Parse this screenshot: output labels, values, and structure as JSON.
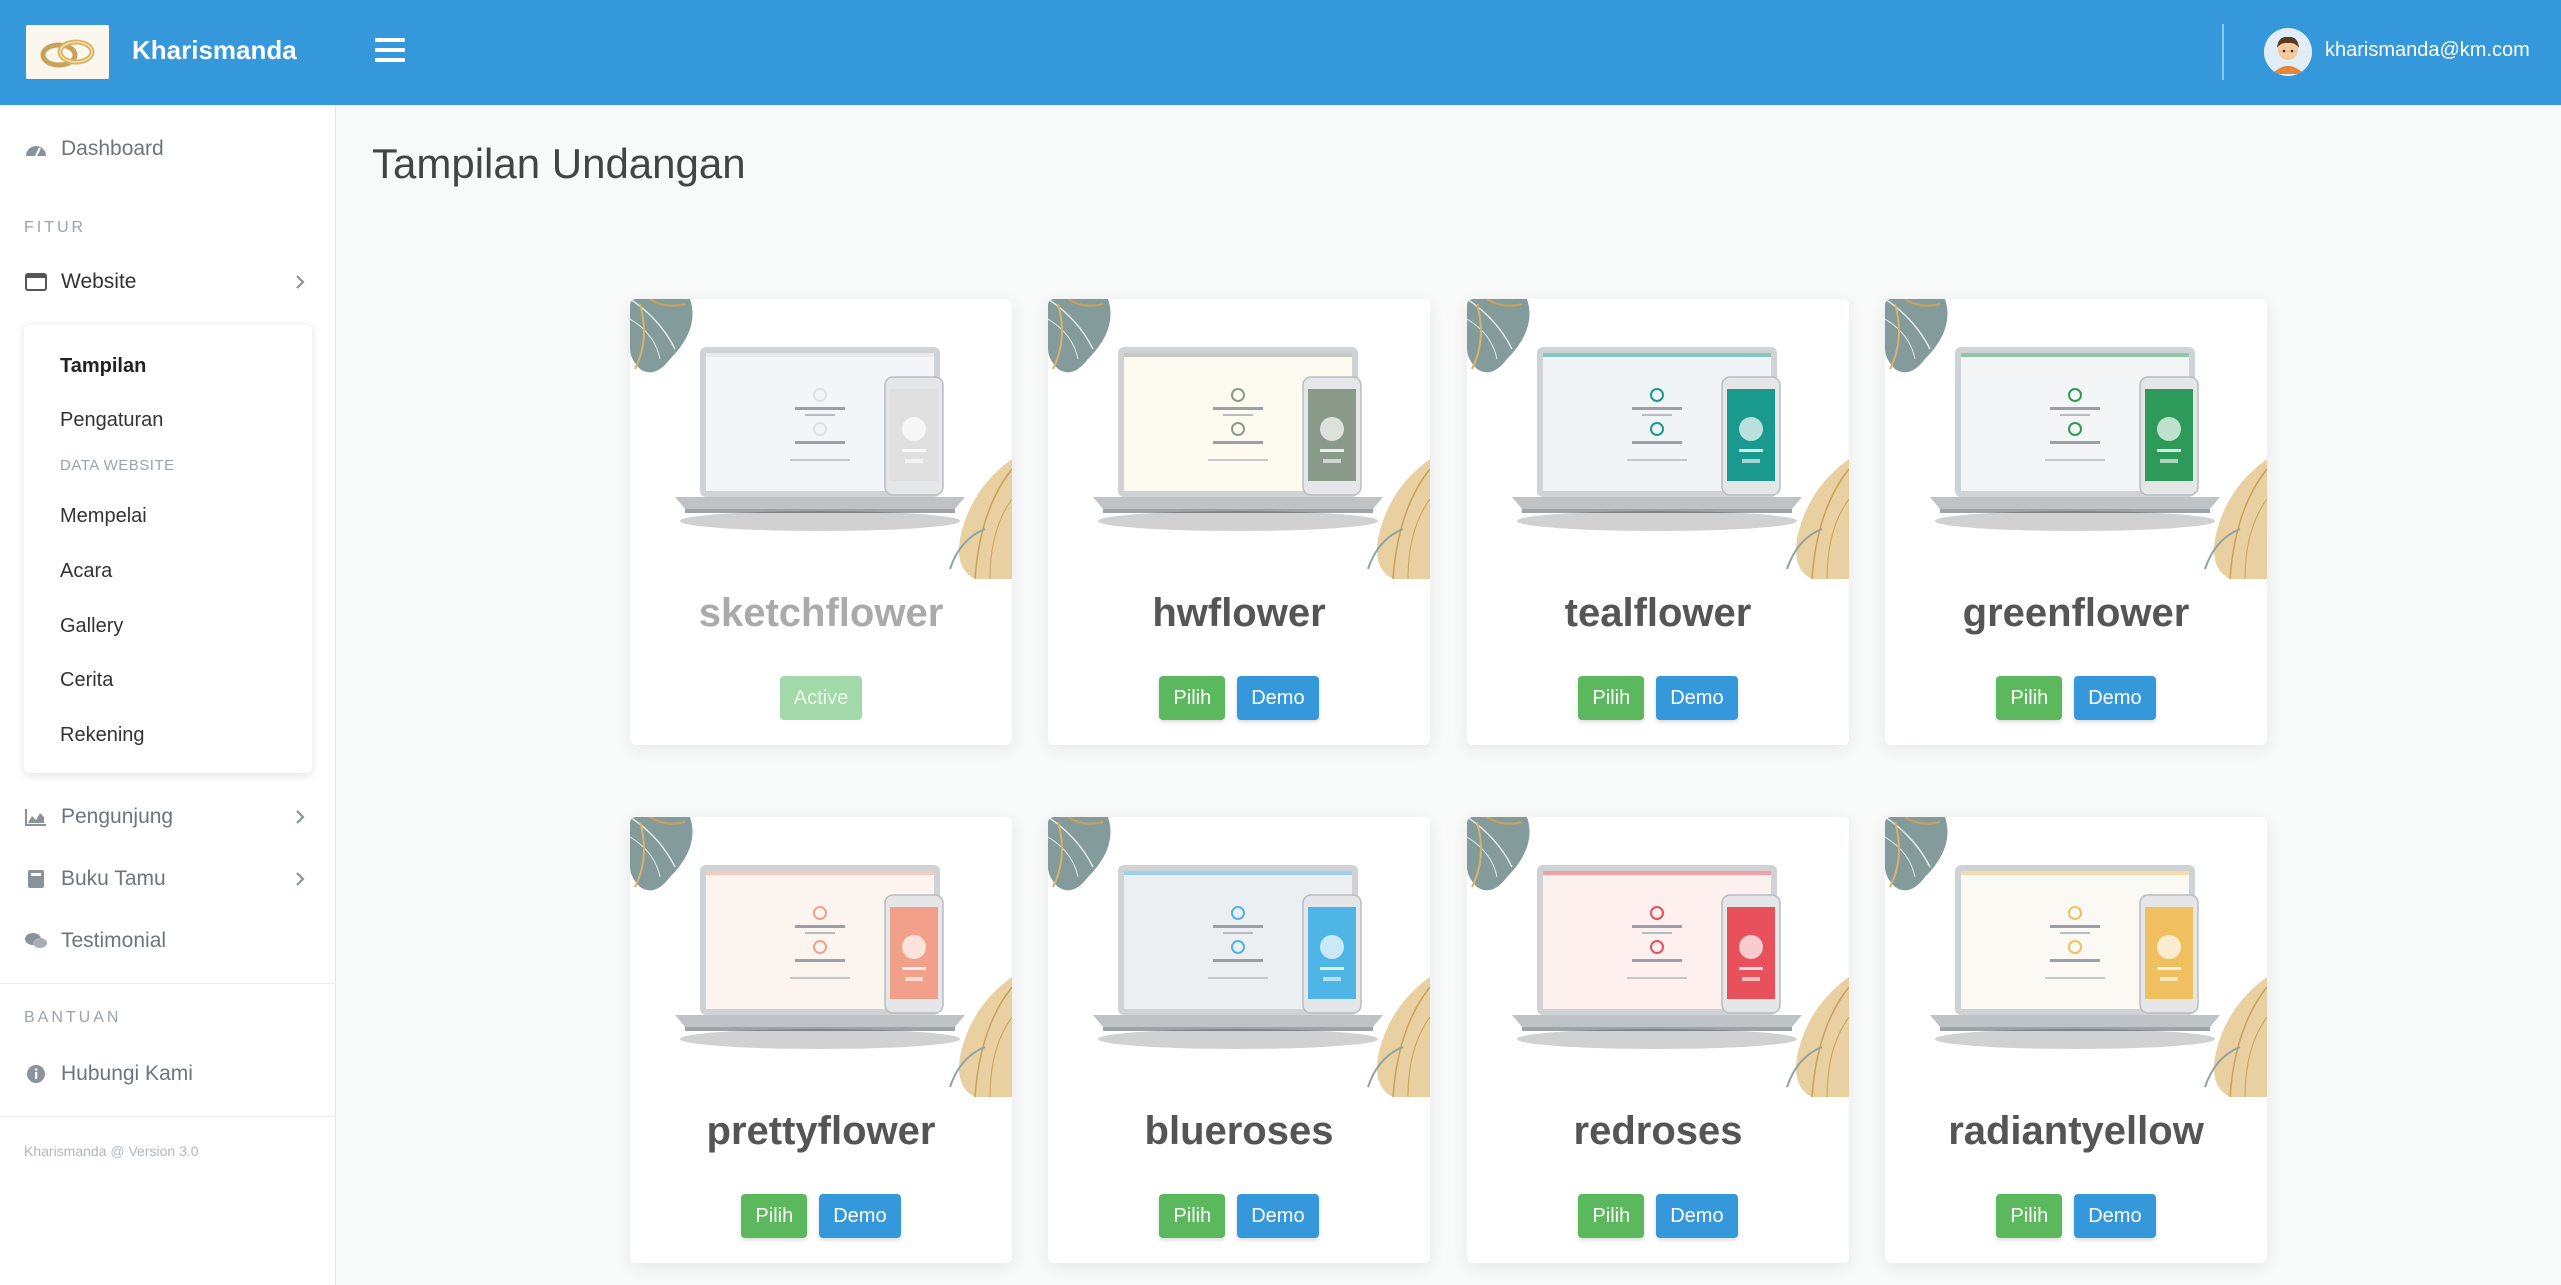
{
  "header": {
    "brand": "Kharismanda",
    "user_email": "kharismanda@km.com"
  },
  "sidebar": {
    "dashboard": "Dashboard",
    "section_fitur": "FITUR",
    "website": "Website",
    "submenu": {
      "tampilan": "Tampilan",
      "pengaturan": "Pengaturan",
      "data_header": "DATA WEBSITE",
      "mempelai": "Mempelai",
      "acara": "Acara",
      "gallery": "Gallery",
      "cerita": "Cerita",
      "rekening": "Rekening"
    },
    "pengunjung": "Pengunjung",
    "buku_tamu": "Buku Tamu",
    "testimonial": "Testimonial",
    "section_bantuan": "BANTUAN",
    "hubungi_kami": "Hubungi Kami",
    "footer": "Kharismanda @ Version 3.0"
  },
  "main": {
    "title": "Tampilan Undangan",
    "themes": [
      {
        "name": "sketchflower",
        "active": true,
        "active_label": "Active",
        "accent": "#e0e0e0",
        "screen": "#f3f5f8"
      },
      {
        "name": "hwflower",
        "active": false,
        "pick_label": "Pilih",
        "demo_label": "Demo",
        "accent": "#8a9a8a",
        "screen": "#fdfbf0"
      },
      {
        "name": "tealflower",
        "active": false,
        "pick_label": "Pilih",
        "demo_label": "Demo",
        "accent": "#1a9a8e",
        "screen": "#f1f4f7"
      },
      {
        "name": "greenflower",
        "active": false,
        "pick_label": "Pilih",
        "demo_label": "Demo",
        "accent": "#2e9a5a",
        "screen": "#f3f5f6"
      },
      {
        "name": "prettyflower",
        "active": false,
        "pick_label": "Pilih",
        "demo_label": "Demo",
        "accent": "#f2a08a",
        "screen": "#fbf4ef"
      },
      {
        "name": "blueroses",
        "active": false,
        "pick_label": "Pilih",
        "demo_label": "Demo",
        "accent": "#4fb4e6",
        "screen": "#eceff1"
      },
      {
        "name": "redroses",
        "active": false,
        "pick_label": "Pilih",
        "demo_label": "Demo",
        "accent": "#e8505b",
        "screen": "#fdf0ef"
      },
      {
        "name": "radiantyellow",
        "active": false,
        "pick_label": "Pilih",
        "demo_label": "Demo",
        "accent": "#f0c060",
        "screen": "#faf9f3"
      }
    ]
  }
}
